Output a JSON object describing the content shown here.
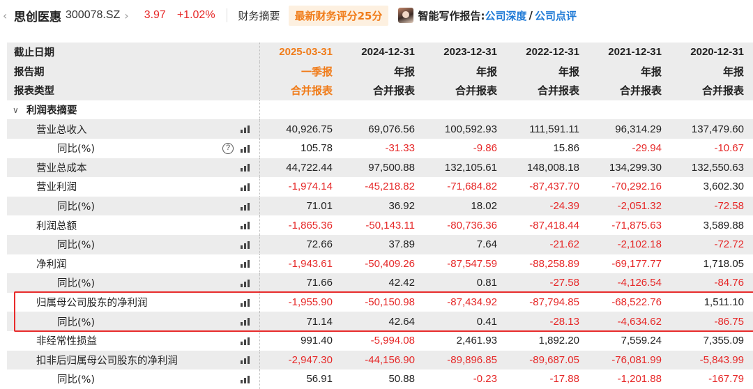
{
  "header": {
    "back_glyph": "‹",
    "stock_name": "思创医惠",
    "stock_code": "300078.SZ",
    "forward_glyph": "›",
    "price": "3.97",
    "change": "+1.02%",
    "tab_finance": "财务摘要",
    "score_badge": "最新财务评分25分",
    "report_label": "智能写作报告:",
    "report_link_1": "公司深度",
    "report_slash": "/",
    "report_link_2": "公司点评",
    "colors": {
      "up": "#e62828",
      "accent": "#f07c1a",
      "link": "#1f7ad6"
    }
  },
  "table": {
    "header_rows": [
      {
        "label": "截止日期",
        "values": [
          "2025-03-31",
          "2024-12-31",
          "2023-12-31",
          "2022-12-31",
          "2021-12-31",
          "2020-12-31"
        ]
      },
      {
        "label": "报告期",
        "values": [
          "一季报",
          "年报",
          "年报",
          "年报",
          "年报",
          "年报"
        ]
      },
      {
        "label": "报表类型",
        "values": [
          "合并报表",
          "合并报表",
          "合并报表",
          "合并报表",
          "合并报表",
          "合并报表"
        ]
      }
    ],
    "section_label": "利润表摘要",
    "section_chevron": "∨",
    "help_glyph": "?",
    "rows": [
      {
        "label": "营业总收入",
        "values": [
          "40,926.75",
          "69,076.56",
          "100,592.93",
          "111,591.11",
          "96,314.29",
          "137,479.60"
        ]
      },
      {
        "label": "同比(%)",
        "values": [
          "105.78",
          "-31.33",
          "-9.86",
          "15.86",
          "-29.94",
          "-10.67"
        ]
      },
      {
        "label": "营业总成本",
        "values": [
          "44,722.44",
          "97,500.88",
          "132,105.61",
          "148,008.18",
          "134,299.30",
          "132,550.63"
        ]
      },
      {
        "label": "营业利润",
        "values": [
          "-1,974.14",
          "-45,218.82",
          "-71,684.82",
          "-87,437.70",
          "-70,292.16",
          "3,602.30"
        ]
      },
      {
        "label": "同比(%)",
        "values": [
          "71.01",
          "36.92",
          "18.02",
          "-24.39",
          "-2,051.32",
          "-72.58"
        ]
      },
      {
        "label": "利润总额",
        "values": [
          "-1,865.36",
          "-50,143.11",
          "-80,736.36",
          "-87,418.44",
          "-71,875.63",
          "3,589.88"
        ]
      },
      {
        "label": "同比(%)",
        "values": [
          "72.66",
          "37.89",
          "7.64",
          "-21.62",
          "-2,102.18",
          "-72.72"
        ]
      },
      {
        "label": "净利润",
        "values": [
          "-1,943.61",
          "-50,409.26",
          "-87,547.59",
          "-88,258.89",
          "-69,177.77",
          "1,718.05"
        ]
      },
      {
        "label": "同比(%)",
        "values": [
          "71.66",
          "42.42",
          "0.81",
          "-27.58",
          "-4,126.54",
          "-84.76"
        ]
      },
      {
        "label": "归属母公司股东的净利润",
        "values": [
          "-1,955.90",
          "-50,150.98",
          "-87,434.92",
          "-87,794.85",
          "-68,522.76",
          "1,511.10"
        ]
      },
      {
        "label": "同比(%)",
        "values": [
          "71.14",
          "42.64",
          "0.41",
          "-28.13",
          "-4,634.62",
          "-86.75"
        ]
      },
      {
        "label": "非经常性损益",
        "values": [
          "991.40",
          "-5,994.08",
          "2,461.93",
          "1,892.20",
          "7,559.24",
          "7,355.09"
        ]
      },
      {
        "label": "扣非后归属母公司股东的净利润",
        "values": [
          "-2,947.30",
          "-44,156.90",
          "-89,896.85",
          "-89,687.05",
          "-76,081.99",
          "-5,843.99"
        ]
      },
      {
        "label": "同比(%)",
        "values": [
          "56.91",
          "50.88",
          "-0.23",
          "-17.88",
          "-1,201.88",
          "-167.79"
        ]
      }
    ]
  }
}
